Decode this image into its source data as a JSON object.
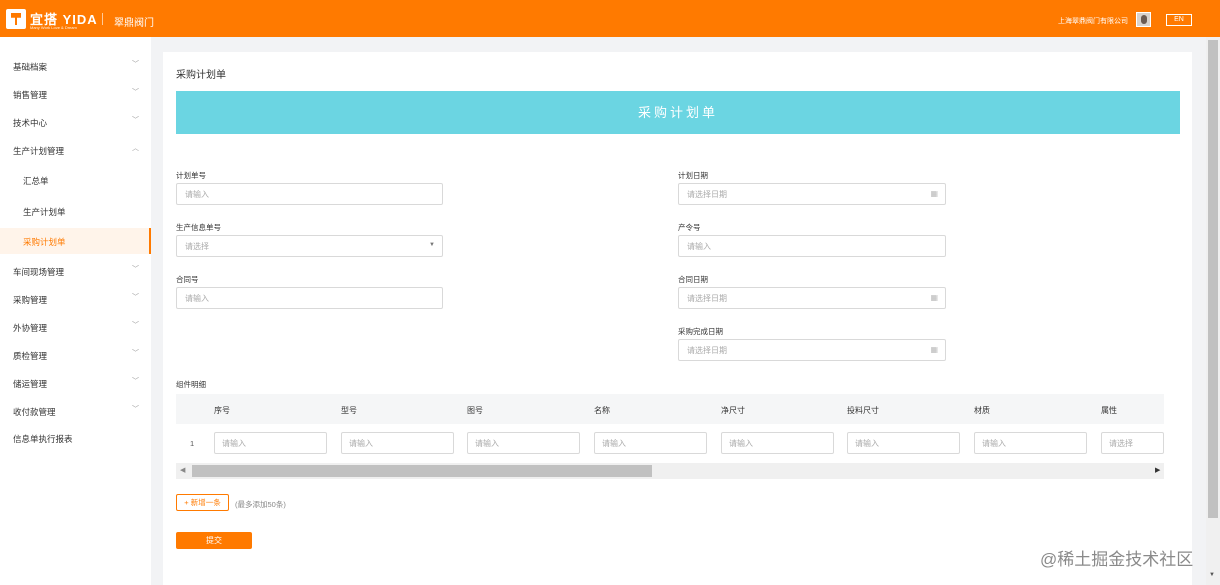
{
  "header": {
    "logo_text": "宜搭 YIDA",
    "logo_sub": "Many Work Love & Dream",
    "app_name": "翠鼎阀门",
    "company": "上海翠鼎阀门有限公司",
    "lang": "EN"
  },
  "sidebar": {
    "items": [
      {
        "label": "基础档案"
      },
      {
        "label": "销售管理"
      },
      {
        "label": "技术中心"
      },
      {
        "label": "生产计划管理"
      },
      {
        "label": "汇总单"
      },
      {
        "label": "生产计划单"
      },
      {
        "label": "采购计划单"
      },
      {
        "label": "车间现场管理"
      },
      {
        "label": "采购管理"
      },
      {
        "label": "外协管理"
      },
      {
        "label": "质检管理"
      },
      {
        "label": "储运管理"
      },
      {
        "label": "收付款管理"
      },
      {
        "label": "信息单执行报表"
      }
    ]
  },
  "page": {
    "title": "采购计划单",
    "banner": "采购计划单"
  },
  "form": {
    "plan_no_label": "计划单号",
    "plan_no_placeholder": "请输入",
    "plan_date_label": "计划日期",
    "plan_date_placeholder": "请选择日期",
    "prod_info_label": "生产信息单号",
    "prod_info_placeholder": "请选择",
    "order_no_label": "产令号",
    "order_no_placeholder": "请输入",
    "contract_no_label": "合同号",
    "contract_no_placeholder": "请输入",
    "contract_date_label": "合同日期",
    "contract_date_placeholder": "请选择日期",
    "purchase_done_label": "采购完成日期",
    "purchase_done_placeholder": "请选择日期"
  },
  "table": {
    "section_label": "组件明细",
    "headers": [
      "序号",
      "型号",
      "图号",
      "名称",
      "净尺寸",
      "投料尺寸",
      "材质",
      "属性"
    ],
    "row_number": "1",
    "cells": [
      "请输入",
      "请输入",
      "请输入",
      "请输入",
      "请输入",
      "请输入",
      "请输入",
      "请选择"
    ]
  },
  "actions": {
    "add_label": "+ 新增一条",
    "add_hint": "(最多添加50条)",
    "submit_label": "提交"
  },
  "watermark": "@稀土掘金技术社区"
}
